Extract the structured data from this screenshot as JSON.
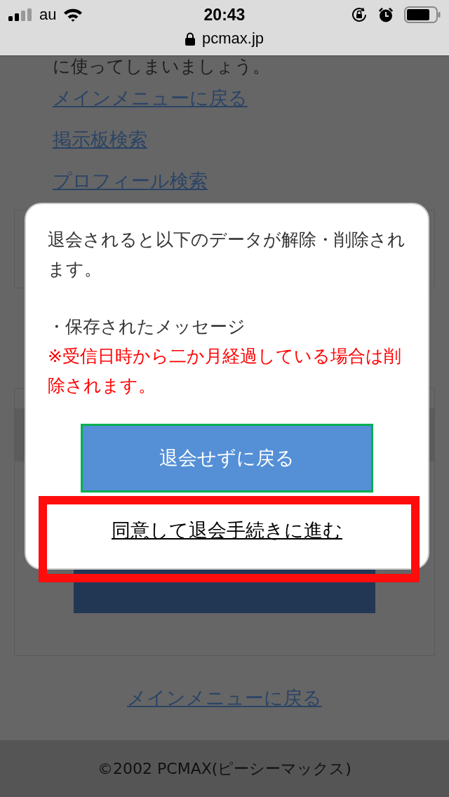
{
  "status_bar": {
    "carrier": "au",
    "time": "20:43"
  },
  "address_bar": {
    "url": "pcmax.jp"
  },
  "page": {
    "intro_text": "に使ってしまいましょう。",
    "links": [
      "メインメニューに戻る",
      "掲示板検索",
      "プロフィール検索"
    ],
    "bottom_link": "メインメニューに戻る",
    "footer": "©2002 PCMAX(ピーシーマックス)"
  },
  "dialog": {
    "message": "退会されると以下のデータが解除・削除されます。",
    "bullet": "・保存されたメッセージ",
    "warning": "※受信日時から二か月経過している場合は削除されます。",
    "cancel_button": "退会せずに戻る",
    "proceed_link": {
      "label": "同意して退会手続きに進む",
      "highlighted": true
    }
  }
}
